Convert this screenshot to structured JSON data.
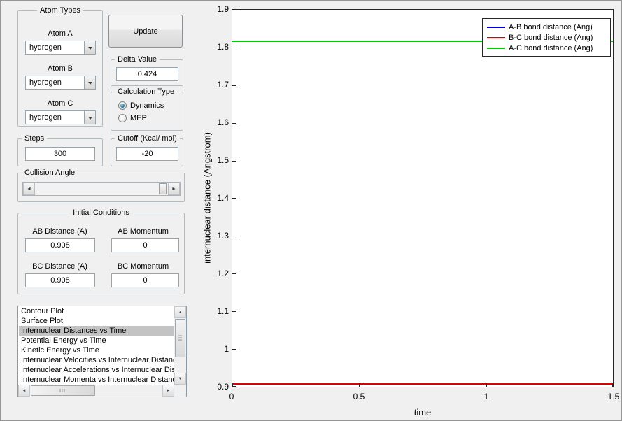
{
  "colors": {
    "bg": "#f0f0f0",
    "selection_gray": "#c3c3c3"
  },
  "controls": {
    "atom_types": {
      "title": "Atom Types",
      "atoms": [
        {
          "label": "Atom A",
          "value": "hydrogen"
        },
        {
          "label": "Atom B",
          "value": "hydrogen"
        },
        {
          "label": "Atom C",
          "value": "hydrogen"
        }
      ]
    },
    "update_button_label": "Update",
    "delta": {
      "title": "Delta Value",
      "value": "0.424"
    },
    "calculation_type": {
      "title": "Calculation Type",
      "options": [
        {
          "label": "Dynamics",
          "selected": true
        },
        {
          "label": "MEP",
          "selected": false
        }
      ]
    },
    "steps": {
      "title": "Steps",
      "value": "300"
    },
    "cutoff": {
      "title": "Cutoff (Kcal/ mol)",
      "value": "-20"
    },
    "collision_angle": {
      "title": "Collision Angle"
    },
    "initial_conditions": {
      "title": "Initial Conditions",
      "fields": [
        {
          "label": "AB Distance (A)",
          "value": "0.908"
        },
        {
          "label": "AB Momentum",
          "value": "0"
        },
        {
          "label": "BC Distance (A)",
          "value": "0.908"
        },
        {
          "label": "BC Momentum",
          "value": "0"
        }
      ]
    },
    "plot_list": {
      "selected_index": 2,
      "items": [
        "Contour Plot",
        "Surface Plot",
        "Internuclear Distances vs Time",
        "Potential Energy vs Time",
        "Kinetic Energy vs Time",
        "Internuclear Velocities vs Internuclear Distance",
        "Internuclear Accelerations vs Internuclear Distance",
        "Internuclear Momenta vs Internuclear Distance"
      ]
    }
  },
  "chart_data": {
    "type": "line",
    "title": "",
    "xlabel": "time",
    "ylabel": "internuclear distance (Angstrom)",
    "xlim": [
      0,
      1.5
    ],
    "ylim": [
      0.9,
      1.9
    ],
    "xticks": [
      0,
      0.5,
      1,
      1.5
    ],
    "yticks": [
      1.9,
      1.8,
      1.7,
      1.6,
      1.5,
      1.4,
      1.3,
      1.2,
      1.1,
      1,
      0.9
    ],
    "grid": false,
    "legend_position": "top-right",
    "series": [
      {
        "name": "A-B bond distance (Ang)",
        "color": "#0000dd",
        "x": [
          0,
          1.5
        ],
        "values": [
          0.908,
          0.908
        ]
      },
      {
        "name": "B-C bond distance (Ang)",
        "color": "#dd0000",
        "x": [
          0,
          1.5
        ],
        "values": [
          0.908,
          0.908
        ]
      },
      {
        "name": "A-C bond distance (Ang)",
        "color": "#00cc00",
        "x": [
          0,
          1.5
        ],
        "values": [
          1.816,
          1.816
        ]
      }
    ]
  }
}
